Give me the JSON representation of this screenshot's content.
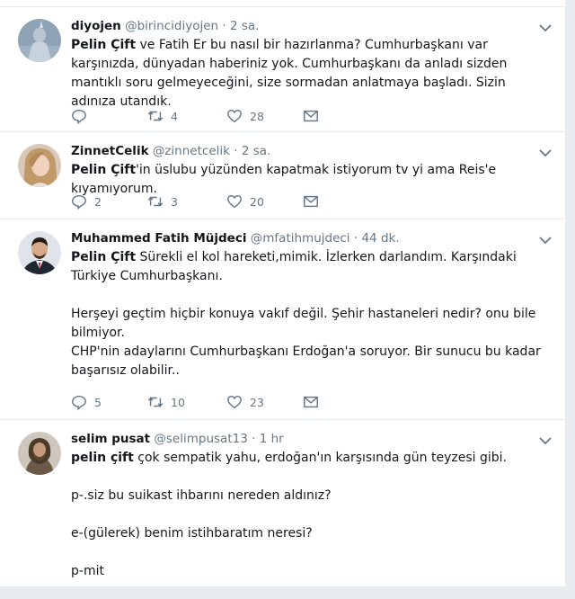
{
  "tweets": [
    {
      "name": "diyojen",
      "handle": "@birincidiyojen",
      "dot": "·",
      "time": "2 sa.",
      "mention": "Pelin Çift",
      "text": " ve Fatih Er bu nasıl bir hazırlanma? Cumhurbaşkanı var karşınızda, dünyadan haberiniz yok. Cumhurbaşkanı da anladı sizden mantıklı soru gelmeyeceğini, size sormadan anlatmaya başladı. Sizin adınıza utandık.",
      "replies": "",
      "retweets": "4",
      "likes": "28"
    },
    {
      "name": "ZinnetCelik",
      "handle": "@zinnetcelik",
      "dot": "·",
      "time": "2 sa.",
      "mention": "Pelin Çift",
      "text": "'in üslubu yüzünden kapatmak istiyorum tv yi ama Reis'e kıyamıyorum.",
      "replies": "2",
      "retweets": "3",
      "likes": "20"
    },
    {
      "name": "Muhammed Fatih Müjdeci",
      "handle": "@mfatihmujdeci",
      "dot": "·",
      "time": "44 dk.",
      "mention": "Pelin Çift",
      "text": " Sürekli el kol hareketi,mimik. İzlerken darlandım. Karşındaki Türkiye Cumhurbaşkanı.\n\nHerşeyi geçtim hiçbir konuya vakıf değil. Şehir hastaneleri nedir? onu bile bilmiyor.\nCHP'nin adaylarını Cumhurbaşkanı Erdoğan'a soruyor. Bir sunucu bu kadar başarısız olabilir..",
      "replies": "5",
      "retweets": "10",
      "likes": "23"
    },
    {
      "name": "selim pusat",
      "handle": "@selimpusat13",
      "dot": "·",
      "time": "1 hr",
      "mention": "pelin çift",
      "text": " çok sempatik yahu, erdoğan'ın karşısında gün teyzesi gibi.\n\np-.siz bu suikast ihbarını nereden aldınız?\n\ne-(gülerek) benim istihbaratım neresi?\n\np-mit"
    }
  ],
  "icons": {
    "reply": "reply-icon",
    "retweet": "retweet-icon",
    "like": "heart-icon",
    "dm": "envelope-icon",
    "more": "chevron-down-icon"
  },
  "colors": {
    "meta": "#657786",
    "text": "#14171a",
    "divider": "#e6ecf0"
  }
}
